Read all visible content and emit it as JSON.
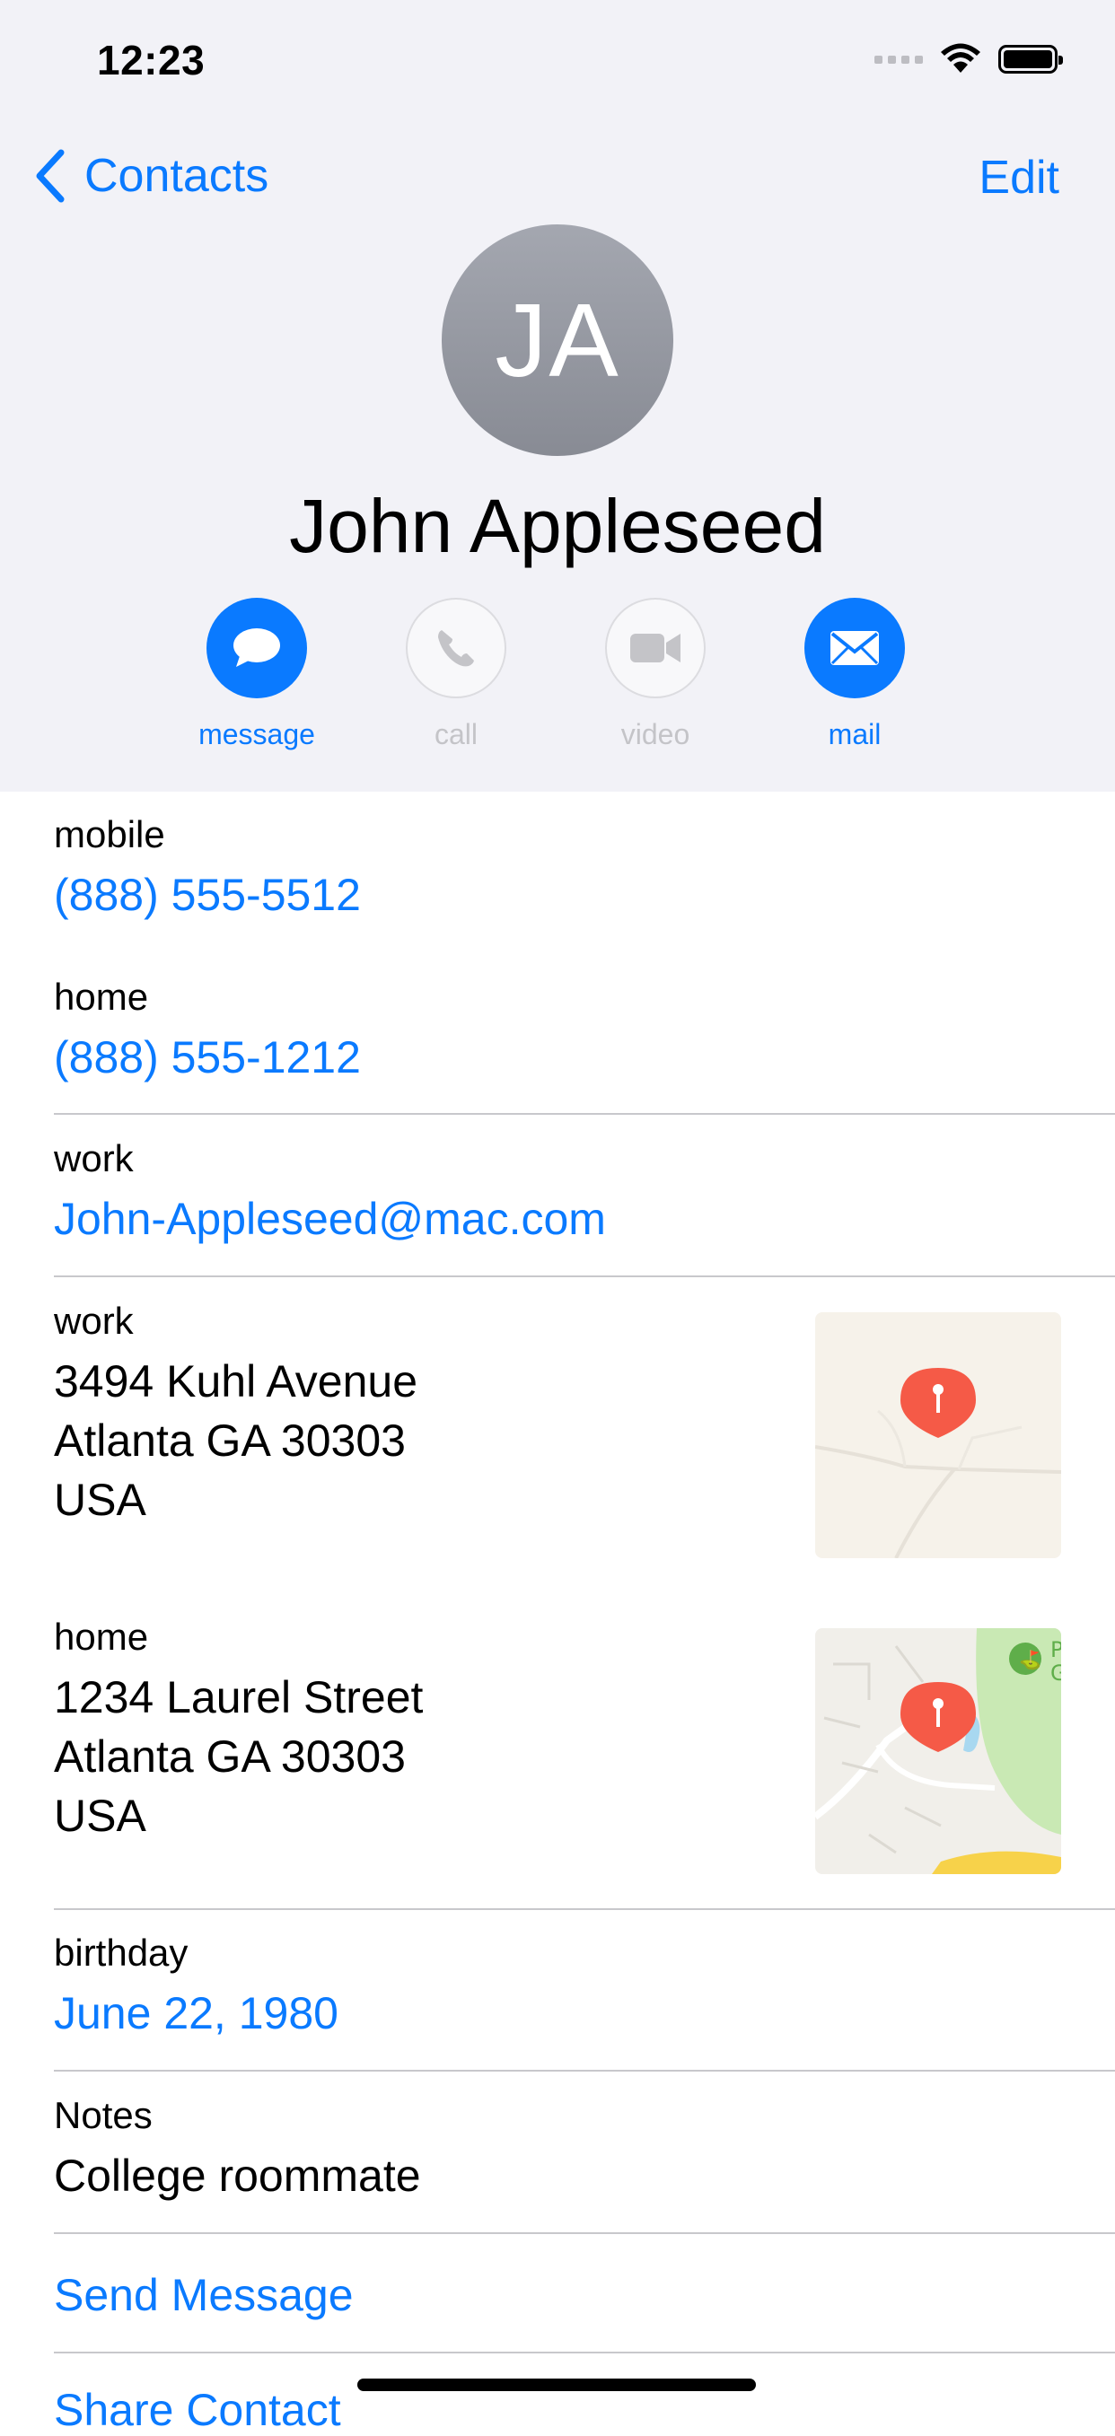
{
  "status_bar": {
    "time": "12:23"
  },
  "nav": {
    "back_label": "Contacts",
    "edit_label": "Edit"
  },
  "contact": {
    "initials": "JA",
    "name": "John Appleseed"
  },
  "actions": [
    {
      "label": "message",
      "enabled": true
    },
    {
      "label": "call",
      "enabled": false
    },
    {
      "label": "video",
      "enabled": false
    },
    {
      "label": "mail",
      "enabled": true
    }
  ],
  "phones": [
    {
      "label": "mobile",
      "value": "(888) 555-5512"
    },
    {
      "label": "home",
      "value": "(888) 555-1212"
    }
  ],
  "email": {
    "label": "work",
    "value": "John-Appleseed@mac.com"
  },
  "addresses": [
    {
      "label": "work",
      "street": "3494 Kuhl Avenue",
      "city": "Atlanta GA 30303",
      "country": "USA"
    },
    {
      "label": "home",
      "street": "1234 Laurel Street",
      "city": "Atlanta GA 30303",
      "country": "USA"
    }
  ],
  "birthday": {
    "label": "birthday",
    "value": "June 22, 1980"
  },
  "notes": {
    "label": "Notes",
    "value": "College roommate"
  },
  "links": {
    "send_message": "Send Message",
    "share_contact": "Share Contact"
  },
  "colors": {
    "accent": "#0a7aff",
    "header_bg": "#f2f2f7",
    "pin": "#f55a47",
    "avatar": "#9a9ca5"
  }
}
